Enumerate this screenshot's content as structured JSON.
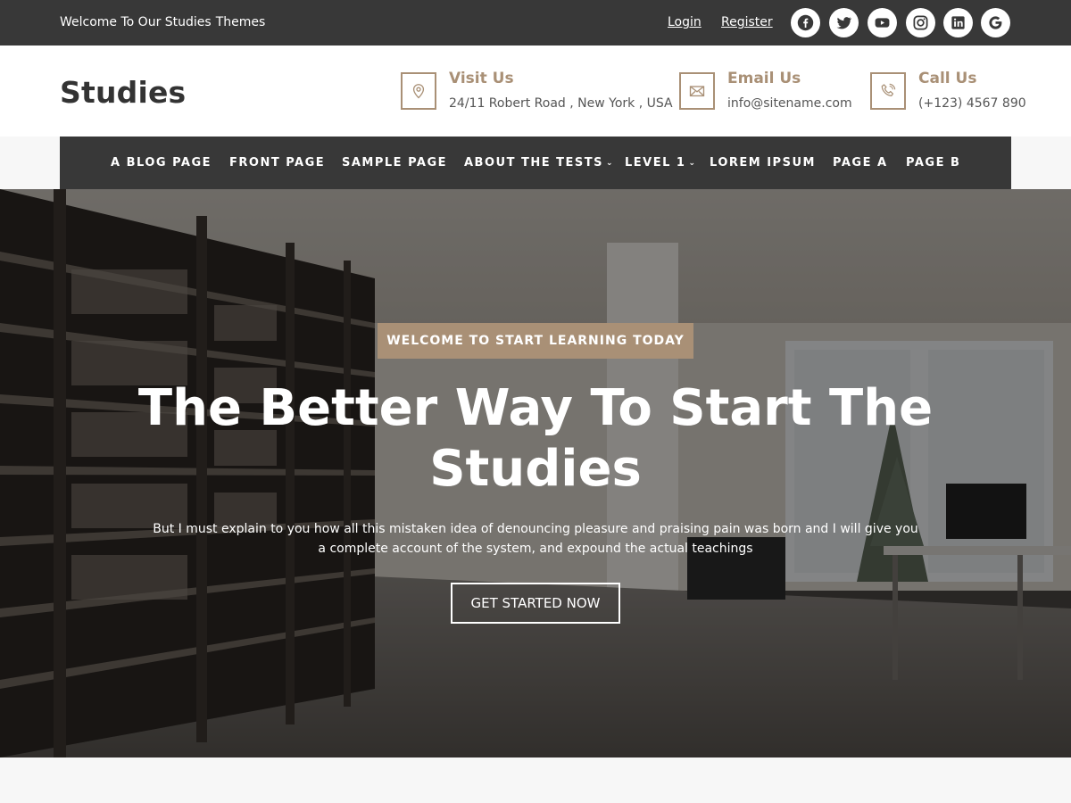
{
  "topbar": {
    "welcome_a": "Welcome To Our Studies",
    "welcome_b": "Themes",
    "login": "Login",
    "register": "Register",
    "social_icons": [
      "facebook-icon",
      "twitter-icon",
      "youtube-icon",
      "instagram-icon",
      "linkedin-icon",
      "google-icon"
    ]
  },
  "header": {
    "brand": "Studies",
    "visit": {
      "title": "Visit Us",
      "value": "24/11 Robert Road , New York , USA",
      "icon": "map-pin-icon"
    },
    "email": {
      "title": "Email Us",
      "value": "info@sitename.com",
      "icon": "envelope-icon"
    },
    "call": {
      "title": "Call Us",
      "value": "(+123) 4567 890",
      "icon": "phone-icon"
    }
  },
  "nav": {
    "items": [
      {
        "label": "A BLOG PAGE"
      },
      {
        "label": "FRONT PAGE"
      },
      {
        "label": "SAMPLE PAGE"
      },
      {
        "label": "ABOUT THE TESTS",
        "dropdown": "⌄"
      },
      {
        "label": "LEVEL 1",
        "dropdown": "⌄"
      },
      {
        "label": "LOREM IPSUM"
      },
      {
        "label": "PAGE A"
      },
      {
        "label": "PAGE B"
      }
    ]
  },
  "hero": {
    "badge": "WELCOME TO START LEARNING TODAY",
    "title": "The Better Way To Start The Studies",
    "text": "But I must explain to you how all this mistaken idea of denouncing pleasure and praising pain was born and I will give you a complete account of the system, and expound the actual teachings",
    "cta": "GET STARTED NOW",
    "image": "library-photo"
  },
  "colors": {
    "dark": "#383838",
    "accent": "#a99076",
    "white": "#ffffff"
  }
}
